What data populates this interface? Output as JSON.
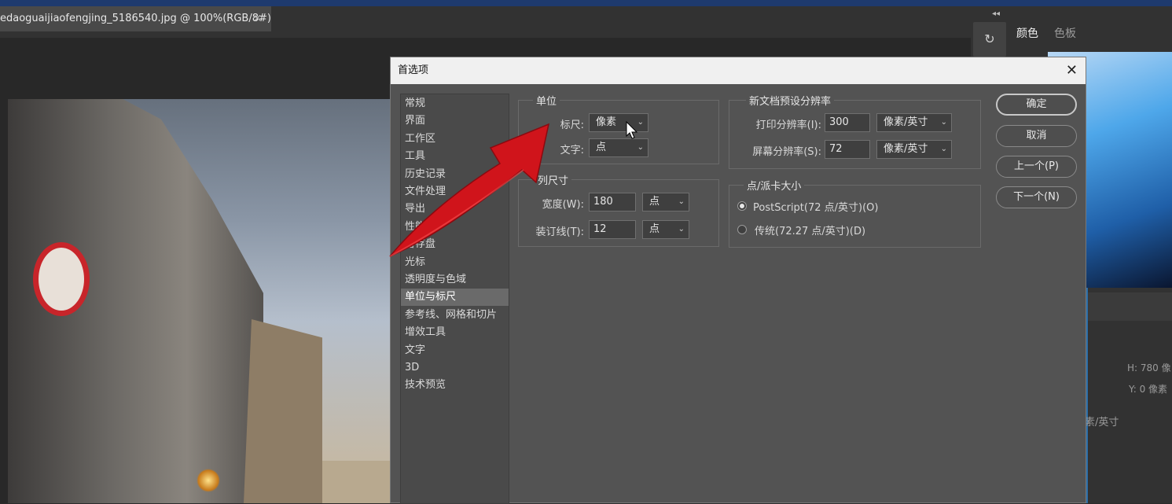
{
  "document": {
    "tab_title": "edaoguaijiaofengjing_5186540.jpg @ 100%(RGB/8#)",
    "tab_close": "×"
  },
  "right_panel": {
    "collapse": "◂◂",
    "tabs": [
      "颜色",
      "色板"
    ],
    "info_h": "H:  780  像",
    "info_y": "Y:  0  像素",
    "info_unit": "素/英寸"
  },
  "dialog": {
    "title": "首选项",
    "close": "✕",
    "sidebar": [
      "常规",
      "界面",
      "工作区",
      "工具",
      "历史记录",
      "文件处理",
      "导出",
      "性能",
      "暂存盘",
      "光标",
      "透明度与色域",
      "单位与标尺",
      "参考线、网格和切片",
      "增效工具",
      "文字",
      "3D",
      "技术预览"
    ],
    "selected_index": 11,
    "units": {
      "label": "单位",
      "ruler_label": "标尺:",
      "ruler_value": "像素",
      "type_label": "文字:",
      "type_value": "点"
    },
    "column_size": {
      "label": "列尺寸",
      "width_label": "宽度(W):",
      "width_value": "180",
      "width_unit": "点",
      "gutter_label": "装订线(T):",
      "gutter_value": "12",
      "gutter_unit": "点"
    },
    "new_doc": {
      "label": "新文档预设分辨率",
      "print_label": "打印分辨率(I):",
      "print_value": "300",
      "print_unit": "像素/英寸",
      "screen_label": "屏幕分辨率(S):",
      "screen_value": "72",
      "screen_unit": "像素/英寸"
    },
    "point_size": {
      "label": "点/派卡大小",
      "postscript": "PostScript(72 点/英寸)(O)",
      "traditional": "传统(72.27 点/英寸)(D)",
      "selected": "postscript"
    },
    "buttons": {
      "ok": "确定",
      "cancel": "取消",
      "prev": "上一个(P)",
      "next": "下一个(N)"
    }
  },
  "colors": {
    "annotation_arrow": "#d0141b",
    "title_bar": "#f0f0f0",
    "dialog_bg": "#535353"
  }
}
